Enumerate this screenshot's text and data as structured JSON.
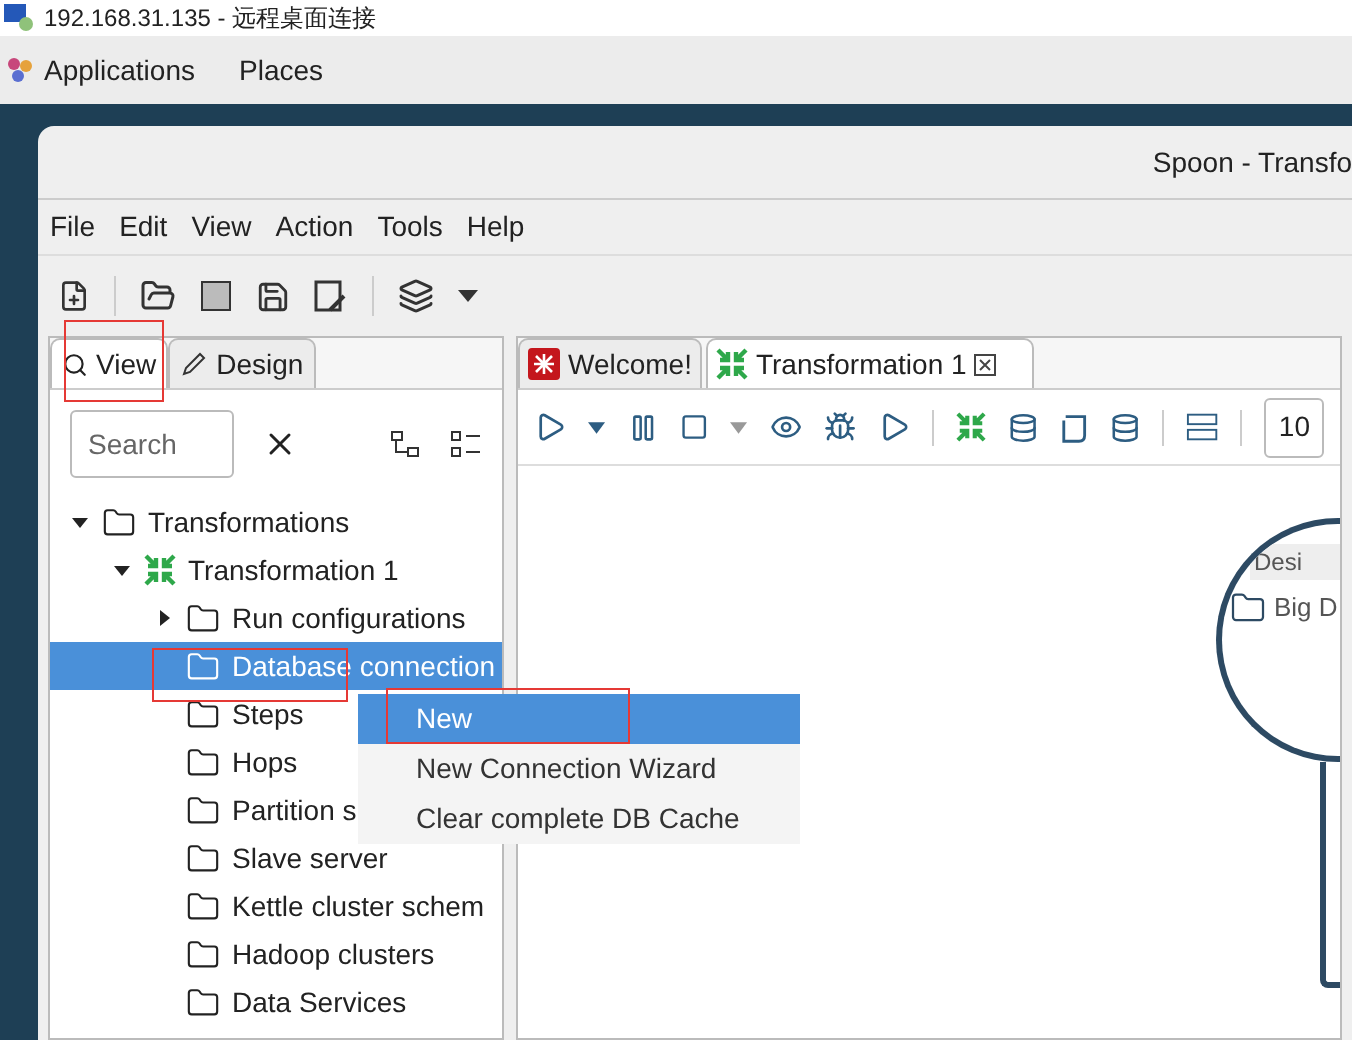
{
  "remote_window": {
    "title": "192.168.31.135 - 远程桌面连接"
  },
  "desktop_bar": {
    "items": [
      "Applications",
      "Places"
    ]
  },
  "window": {
    "title": "Spoon - Transfo"
  },
  "menu_bar": [
    "File",
    "Edit",
    "View",
    "Action",
    "Tools",
    "Help"
  ],
  "left_tabs": [
    {
      "label": "View",
      "selected": true
    },
    {
      "label": "Design",
      "selected": false
    }
  ],
  "search": {
    "placeholder": "Search"
  },
  "tree": [
    {
      "label": "Transformations",
      "kind": "folder",
      "expanded": true,
      "selected": false,
      "children": [
        {
          "label": "Transformation 1",
          "kind": "transformation",
          "expanded": true,
          "selected": false,
          "children": [
            {
              "label": "Run configurations",
              "kind": "folder",
              "expanded": false,
              "selected": false
            },
            {
              "label": "Database connection",
              "kind": "folder",
              "selected": true
            },
            {
              "label": "Steps",
              "kind": "folder",
              "selected": false
            },
            {
              "label": "Hops",
              "kind": "folder",
              "selected": false
            },
            {
              "label": "Partition s",
              "kind": "folder",
              "selected": false
            },
            {
              "label": "Slave server",
              "kind": "folder",
              "selected": false
            },
            {
              "label": "Kettle cluster schem",
              "kind": "folder",
              "selected": false
            },
            {
              "label": "Hadoop clusters",
              "kind": "folder",
              "selected": false
            },
            {
              "label": "Data Services",
              "kind": "folder",
              "selected": false
            }
          ]
        }
      ]
    }
  ],
  "editor_tabs": [
    {
      "label": "Welcome!",
      "kind": "welcome",
      "selected": false
    },
    {
      "label": "Transformation 1",
      "kind": "transformation",
      "selected": true
    }
  ],
  "zoom_field": {
    "value": "10"
  },
  "canvas": {
    "magnifier_tab": "Desi",
    "magnifier_folder": "Big D"
  },
  "context_menu": [
    {
      "label": "New",
      "selected": true
    },
    {
      "label": "New Connection Wizard",
      "selected": false
    },
    {
      "label": "Clear complete DB Cache",
      "selected": false
    }
  ]
}
